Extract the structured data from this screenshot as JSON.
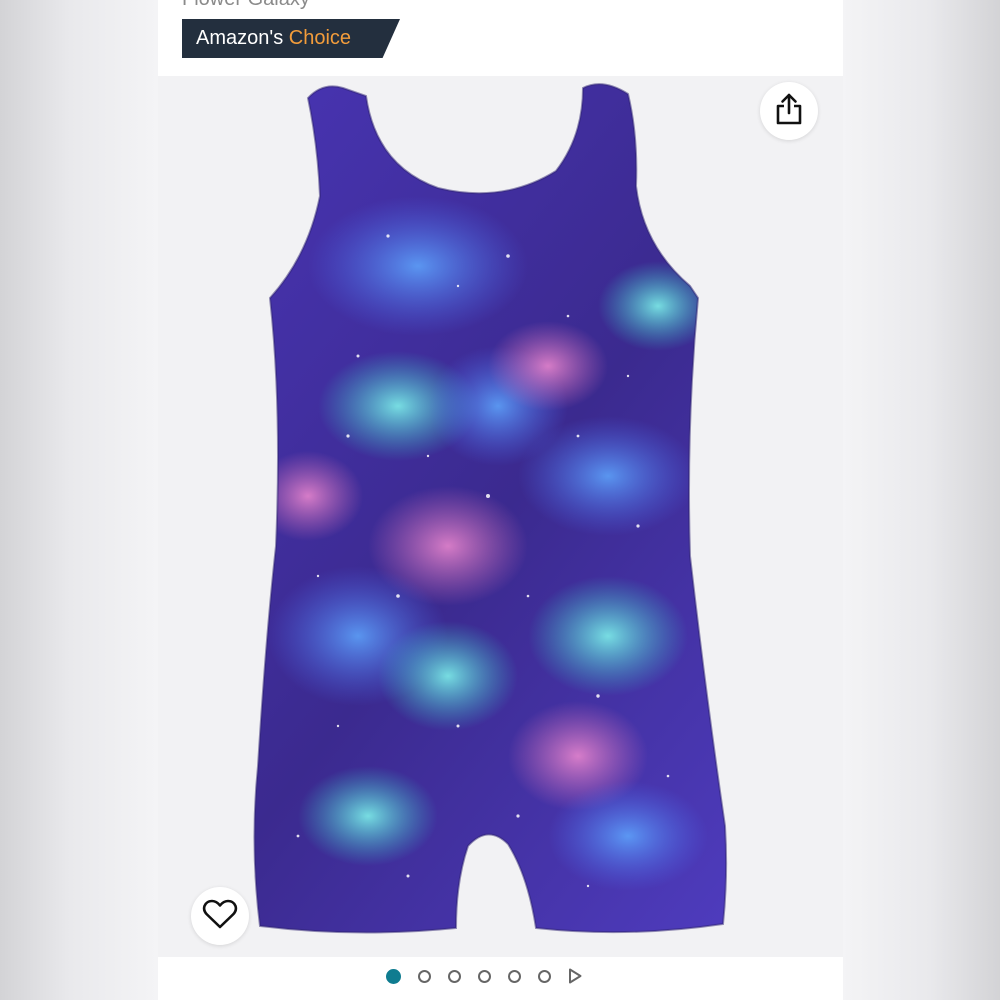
{
  "product": {
    "subtitle": "Flower Galaxy",
    "badge": {
      "part1": "Amazon's",
      "part2": "Choice",
      "background": "#232f3e",
      "accent": "#f29c3b"
    },
    "image": {
      "subject": "galaxy print sleeveless biketard leotard",
      "colors": [
        "#3b2a8f",
        "#5b3cc4",
        "#2ec4c6",
        "#d86fb5"
      ]
    }
  },
  "icons": {
    "share": "share-icon",
    "favorite": "heart-icon",
    "next": "play-next-icon"
  },
  "carousel": {
    "total_dots": 6,
    "active_index": 0,
    "active_color": "#0f7c90"
  }
}
